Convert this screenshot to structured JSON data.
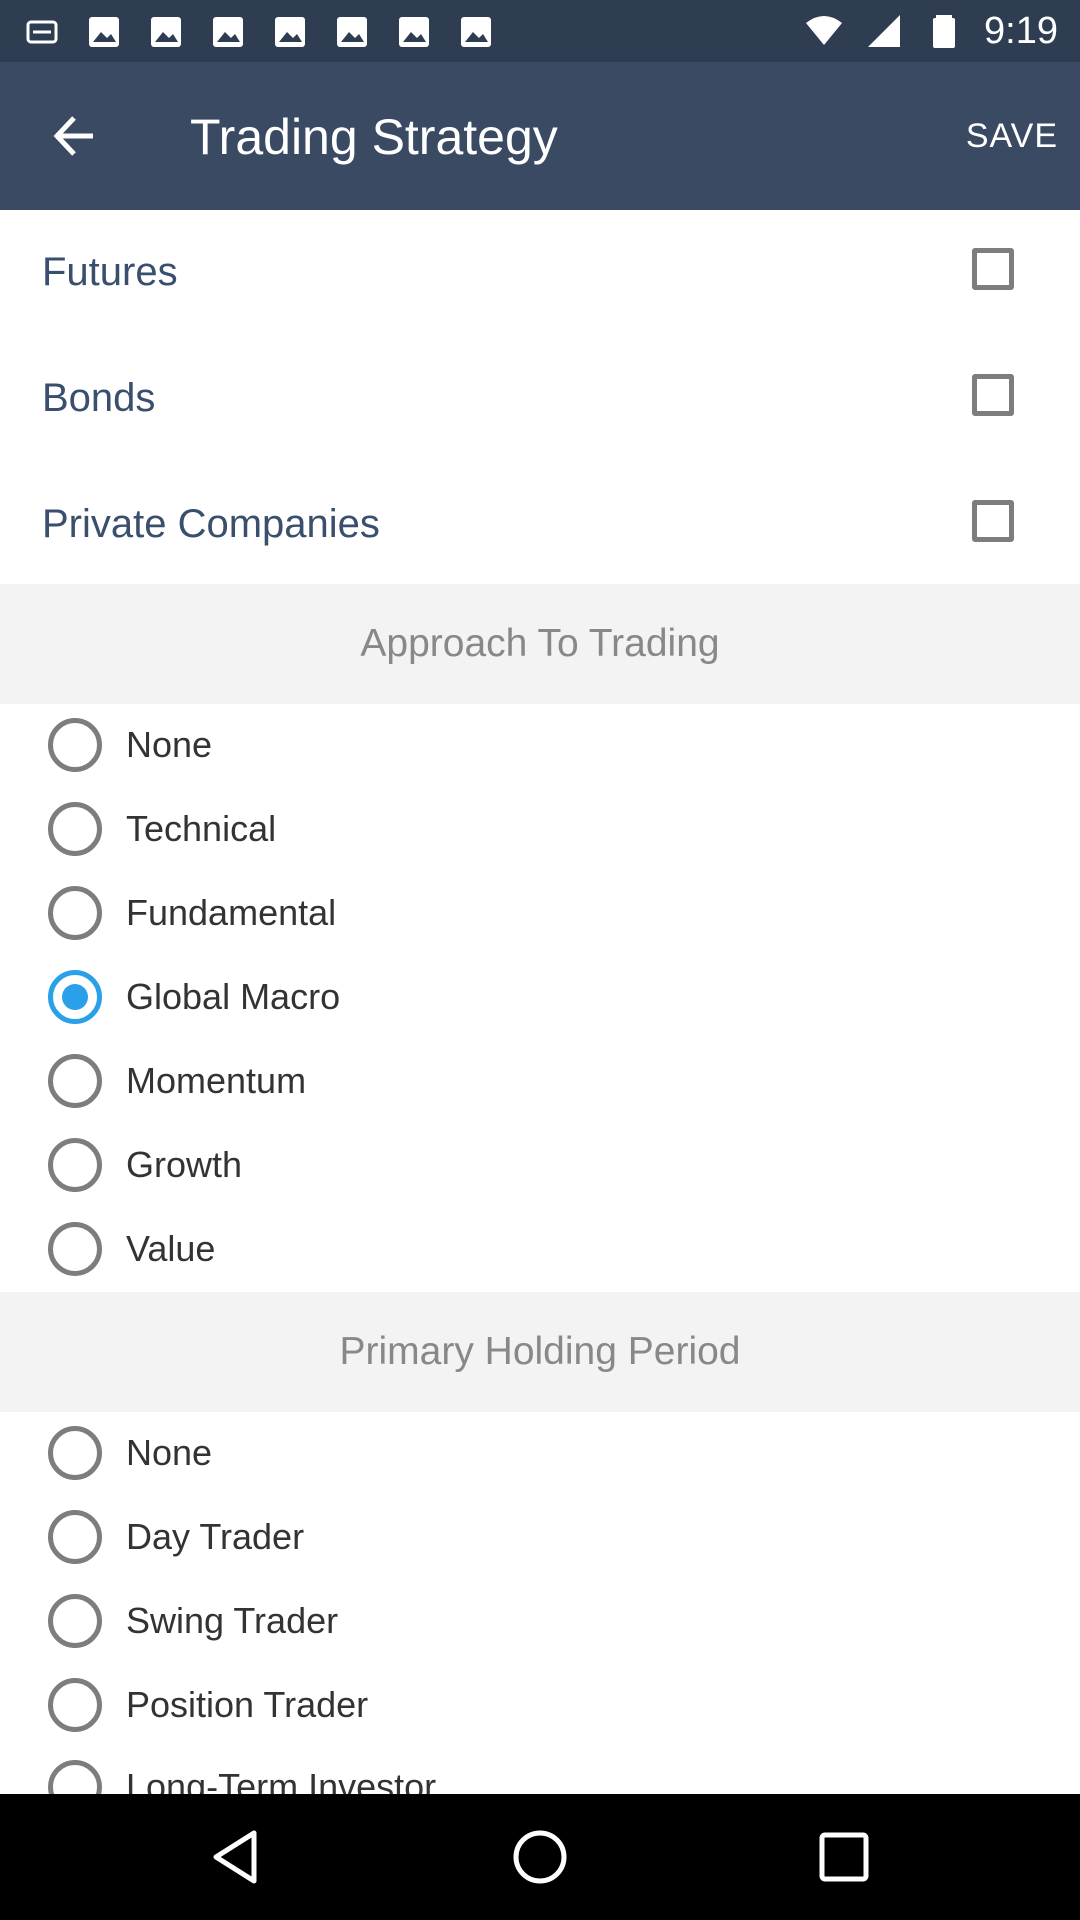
{
  "status_bar": {
    "time": "9:19",
    "left_icons": [
      "app-notification-icon",
      "image-icon",
      "image-icon",
      "image-icon",
      "image-icon",
      "image-icon",
      "image-icon"
    ],
    "right_icons": [
      "wifi-icon",
      "signal-icon",
      "battery-icon"
    ]
  },
  "app_bar": {
    "back_icon": "arrow-left-icon",
    "title": "Trading Strategy",
    "save_label": "SAVE",
    "background_color": "#3a4a63"
  },
  "asset_classes": [
    {
      "label": "Futures",
      "checked": false
    },
    {
      "label": "Bonds",
      "checked": false
    },
    {
      "label": "Private Companies",
      "checked": false
    }
  ],
  "approach": {
    "header": "Approach To Trading",
    "options": [
      {
        "label": "None",
        "selected": false
      },
      {
        "label": "Technical",
        "selected": false
      },
      {
        "label": "Fundamental",
        "selected": false
      },
      {
        "label": "Global Macro",
        "selected": true
      },
      {
        "label": "Momentum",
        "selected": false
      },
      {
        "label": "Growth",
        "selected": false
      },
      {
        "label": "Value",
        "selected": false
      }
    ]
  },
  "holding_period": {
    "header": "Primary Holding Period",
    "options": [
      {
        "label": "None",
        "selected": false
      },
      {
        "label": "Day Trader",
        "selected": false
      },
      {
        "label": "Swing Trader",
        "selected": false
      },
      {
        "label": "Position Trader",
        "selected": false
      },
      {
        "label": "Long-Term Investor",
        "selected": false
      }
    ]
  },
  "nav_bar": {
    "buttons": [
      "back-triangle-icon",
      "home-circle-icon",
      "recents-square-icon"
    ]
  },
  "colors": {
    "accent": "#2aa0e8",
    "status_bar": "#2e3d52",
    "section_header_bg": "#f3f3f3"
  }
}
